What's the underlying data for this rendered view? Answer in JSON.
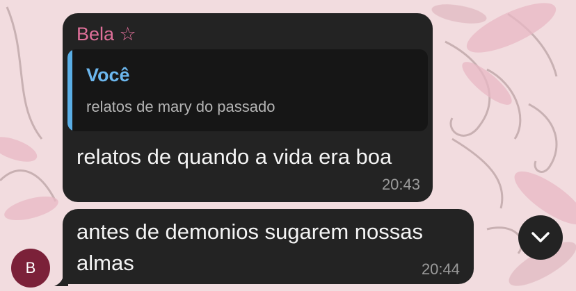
{
  "message1": {
    "sender": "Bela ☆",
    "reply": {
      "author": "Você",
      "text": "relatos de mary do passado"
    },
    "text": "relatos de quando a vida era boa",
    "time": "20:43"
  },
  "message2": {
    "text": "antes de demonios sugarem nossas almas",
    "time": "20:44"
  },
  "avatar": {
    "initial": "B",
    "color": "#7b2139"
  },
  "scroll_button": {
    "icon": "chevron-down-icon"
  },
  "colors": {
    "bubble": "#232323",
    "sender_name": "#e0709a",
    "reply_accent": "#5aaee6",
    "wallpaper": "#f2dcdf"
  }
}
